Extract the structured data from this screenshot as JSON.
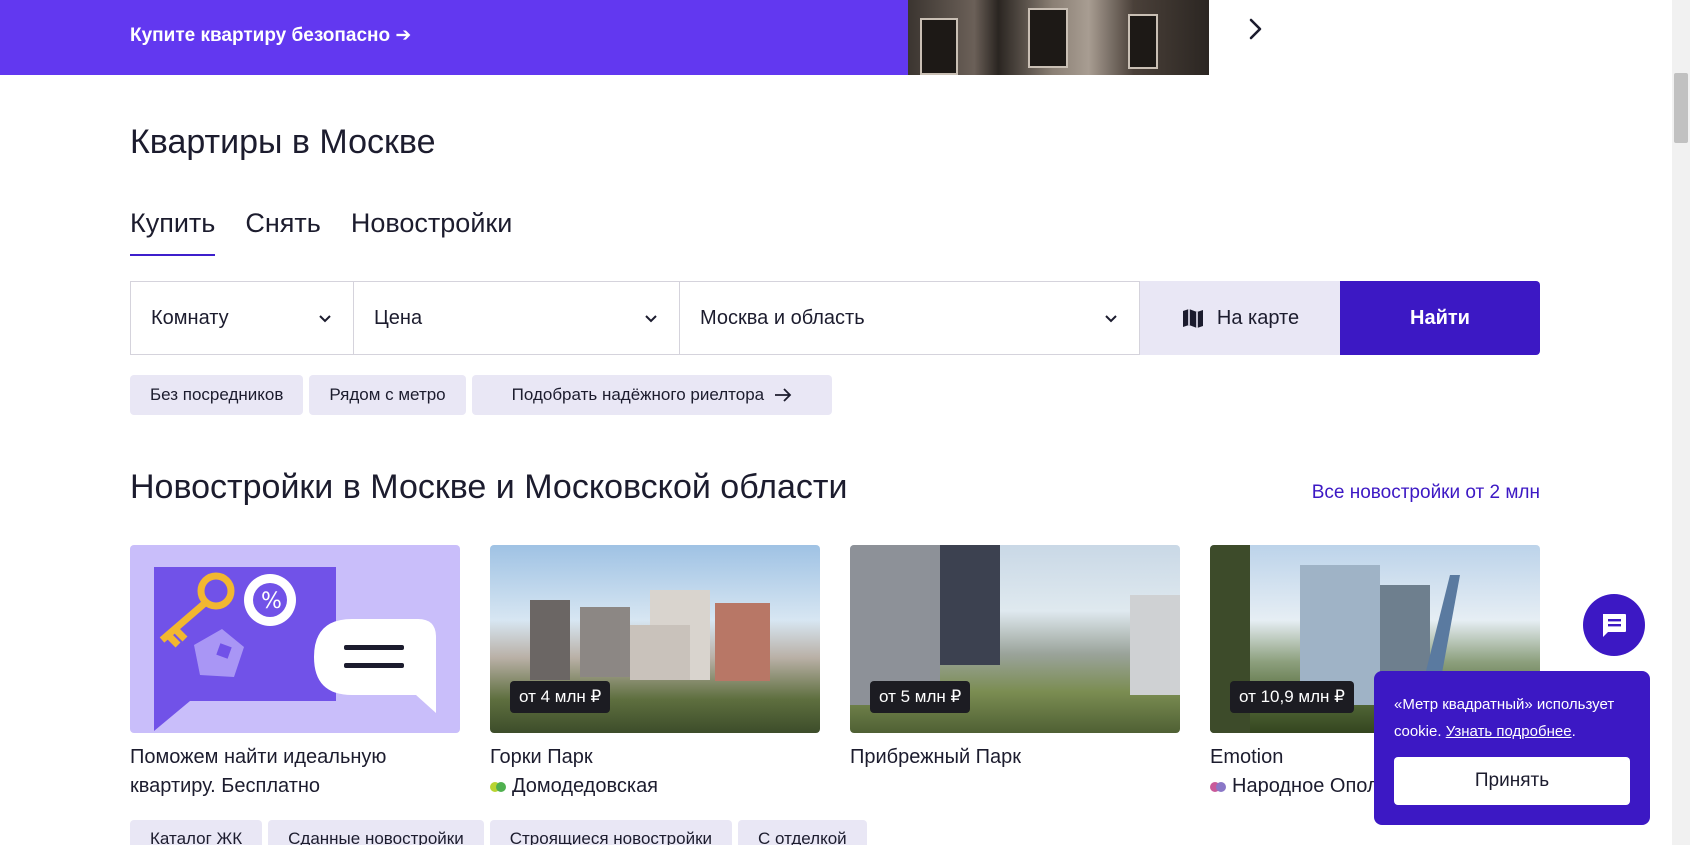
{
  "promo": {
    "text": "Купите квартиру безопасно ➔",
    "next_icon": "chevron-right-icon"
  },
  "heading": "Квартиры в Москве",
  "tabs": [
    {
      "label": "Купить",
      "active": true
    },
    {
      "label": "Снять",
      "active": false
    },
    {
      "label": "Новостройки",
      "active": false
    }
  ],
  "search": {
    "rooms": "Комнату",
    "price": "Цена",
    "region": "Москва и область",
    "map_button": "На карте",
    "find_button": "Найти"
  },
  "chips": [
    {
      "label": "Без посредников"
    },
    {
      "label": "Рядом с метро"
    },
    {
      "label": "Подобрать надёжного риелтора"
    }
  ],
  "newbuilds": {
    "heading": "Новостройки в Москве и Московской области",
    "all_link": "Все новостройки от 2 млн",
    "cards": [
      {
        "title": "Поможем найти идеальную квартиру. Бесплатно"
      },
      {
        "title": "Горки Парк",
        "price": "от 4 млн ₽",
        "metro": "Домодедовская",
        "metro_colors": [
          "#b8d432",
          "#4fb04f"
        ]
      },
      {
        "title": "Прибрежный Парк",
        "price": "от 5 млн ₽"
      },
      {
        "title": "Emotion",
        "price": "от 10,9 млн ₽",
        "metro": "Народное Ополчение",
        "metro_colors": [
          "#c95a9a",
          "#8a77c7"
        ]
      }
    ]
  },
  "bottom_chips": [
    {
      "label": "Каталог ЖК"
    },
    {
      "label": "Сданные новостройки"
    },
    {
      "label": "Строящиеся новостройки"
    },
    {
      "label": "С отделкой"
    }
  ],
  "cookie": {
    "text": "«Метр квадратный» использует cookie.",
    "link": "Узнать подробнее",
    "accept": "Принять"
  },
  "colors": {
    "brand": "#3c18c4",
    "promo_bg": "#6238f0",
    "chip_bg": "#e9e7f5"
  }
}
